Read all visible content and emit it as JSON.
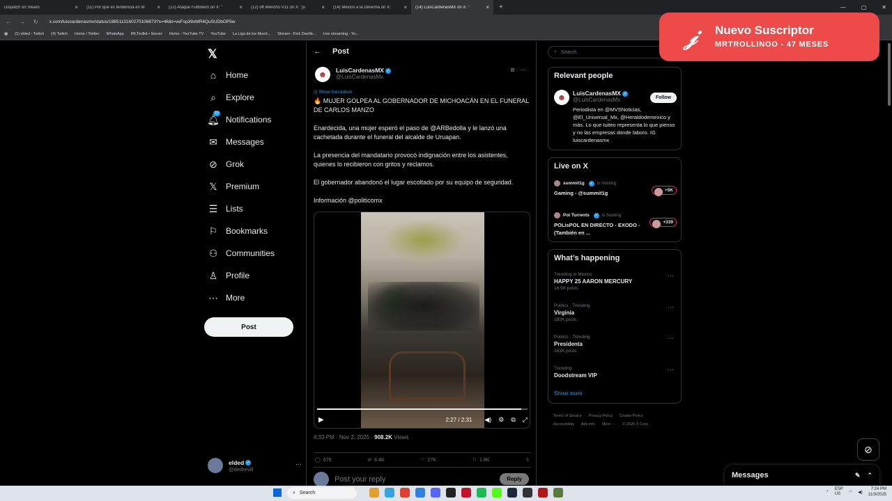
{
  "browser": {
    "tabs": [
      "Dispatch on Steam",
      "(11) Por que es tendencia en M",
      "(12) Ataque Futbolero on X: \"",
      "(12) off Mencho V11 on X: \"ju",
      "(14) México a la Derecha on X:",
      "(14) LuisCardenasMX on X: \""
    ],
    "url": "x.com/luiscardenasmx/status/1985113160270106873?s=46&t=veFsp39xMR4QuSUDbOP5w",
    "bookmarks": [
      "(1) elded - Twitch",
      "(4) Twitch",
      "Home / Twitter",
      "WhatsApp",
      "IRLToolkit • Server",
      "Home - YouTube TV",
      "YouTube",
      "La Liga de los Muert...",
      "Stream - Kick Dashb...",
      "Live streaming - Yo..."
    ]
  },
  "nav": {
    "items": [
      "Home",
      "Explore",
      "Notifications",
      "Messages",
      "Grok",
      "Premium",
      "Lists",
      "Bookmarks",
      "Communities",
      "Profile",
      "More"
    ],
    "notif_badge": "10",
    "post_button": "Post",
    "account": {
      "name": "elded",
      "handle": "@dedrevill"
    }
  },
  "post": {
    "header": "Post",
    "author_name": "LuisCardenasMX",
    "author_handle": "@LuisCardenasMx",
    "show_translation": "Show translation",
    "paragraphs": [
      "🔥 MUJER GOLPEA AL GOBERNADOR DE MICHOACÁN EN EL FUNERAL DE CARLOS MANZO",
      "Enardecida, una mujer esperó el paso de @ARBedolla y le lanzó una cachetada durante el funeral del alcalde de Uruapan.",
      "La presencia del mandatario provocó indignación entre los asistentes, quienes lo recibieron con gritos y reclamos.",
      "El gobernador abandonó el lugar escoltado por su equipo de seguridad.",
      "Información @politicomx"
    ],
    "video_time": "2:27 / 2:31",
    "video_progress": 0.97,
    "time": "4:33 PM · Nov 2, 2025 · ",
    "views": "908.2K",
    "views_label": " Views",
    "stats": {
      "replies": "676",
      "reposts": "6.4K",
      "likes": "27K",
      "bookmarks": "1.8K"
    },
    "reply_placeholder": "Post your reply",
    "reply_button": "Reply"
  },
  "right": {
    "search_placeholder": "Search",
    "relevant_title": "Relevant people",
    "relevant": {
      "name": "LuisCardenasMX",
      "handle": "@LuisCardenasMx",
      "follow": "Follow",
      "bio": "Periodista en @MVSNoticias, @El_Universal_Mx, @Heraldodemexico y más. Lo que tuiteo representa lo que pienso y no las empresas donde laboro. IG luiscardenasmx"
    },
    "live_title": "Live on X",
    "live": [
      {
        "host": "summit1g",
        "label": "is hosting",
        "title": "Gaming - @summit1g",
        "count": "+5K"
      },
      {
        "host": "Pol Turrents",
        "label": "is hosting",
        "title": "POLisPOL EN DIRECTO - EXODO - (También en ...",
        "count": "+339"
      }
    ],
    "happening_title": "What’s happening",
    "trends": [
      {
        "cat": "Trending in Mexico",
        "name": "HAPPY 25 AARON MERCURY",
        "posts": "18.5K posts"
      },
      {
        "cat": "Politics · Trending",
        "name": "Virginia",
        "posts": "182K posts"
      },
      {
        "cat": "Politics · Trending",
        "name": "Presidenta",
        "posts": "163K posts"
      },
      {
        "cat": "Trending",
        "name": "Doodstream VIP",
        "posts": ""
      }
    ],
    "show_more": "Show more",
    "footer": [
      "Terms of Service",
      "Privacy Policy",
      "Cookie Policy",
      "Accessibility",
      "Ads info",
      "More ···",
      "© 2025 X Corp."
    ]
  },
  "notification": {
    "title": "Nuevo Suscriptor",
    "subtitle": "MRTROLLINOO - 47 MESES",
    "color": "#ef4a4a"
  },
  "messages_dock": "Messages",
  "taskbar": {
    "search": "Search",
    "lang": "ESP\nUS",
    "time": "7:24 PM",
    "date": "11/3/2025"
  }
}
